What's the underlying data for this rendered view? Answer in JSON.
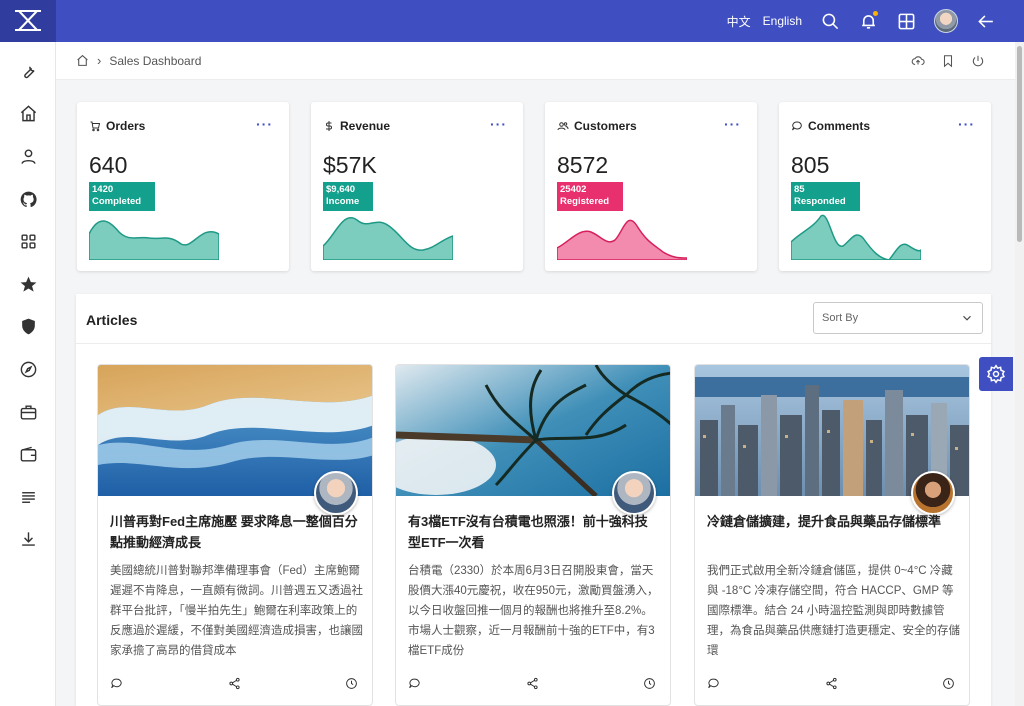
{
  "header": {
    "lang_zh": "中文",
    "lang_en": "English",
    "accent_color": "#3f4fc1"
  },
  "breadcrumb": {
    "page": "Sales Dashboard"
  },
  "stats": [
    {
      "label": "Orders",
      "value": "640",
      "badge_value": "1420",
      "badge_label": "Completed",
      "color": "#13a08c"
    },
    {
      "label": "Revenue",
      "value": "$57K",
      "badge_value": "$9,640",
      "badge_label": "Income",
      "color": "#13a08c"
    },
    {
      "label": "Customers",
      "value": "8572",
      "badge_value": "25402",
      "badge_label": "Registered",
      "color": "#e9306f"
    },
    {
      "label": "Comments",
      "value": "805",
      "badge_value": "85",
      "badge_label": "Responded",
      "color": "#13a08c"
    }
  ],
  "articles": {
    "title": "Articles",
    "sort_placeholder": "Sort By",
    "items": [
      {
        "title": "川普再對Fed主席施壓 要求降息一整個百分點推動經濟成長",
        "body": "美國總統川普對聯邦準備理事會（Fed）主席鮑爾遲遲不肯降息，一直頗有微詞。川普週五又透過社群平台批評，「慢半拍先生」鮑爾在利率政策上的反應過於遲緩，不僅對美國經濟造成損害，也讓國家承擔了高昂的借貸成本"
      },
      {
        "title": "有3檔ETF沒有台積電也照漲！前十強科技型ETF一次看",
        "body": "台積電（2330）於本周6月3日召開股東會，當天股價大漲40元慶祝，收在950元，激勵買盤湧入，以今日收盤回推一個月的報酬也將推升至8.2%。市場人士觀察，近一月報酬前十強的ETF中，有3檔ETF成份"
      },
      {
        "title": "冷鏈倉儲擴建，提升食品與藥品存儲標準",
        "body": "我們正式啟用全新冷鏈倉儲區，提供 0~4°C 冷藏與 -18°C 冷凍存儲空間，符合 HACCP、GMP 等國際標準。結合 24 小時溫控監測與即時數據管理，為食品與藥品供應鏈打造更穩定、安全的存儲環"
      }
    ]
  }
}
